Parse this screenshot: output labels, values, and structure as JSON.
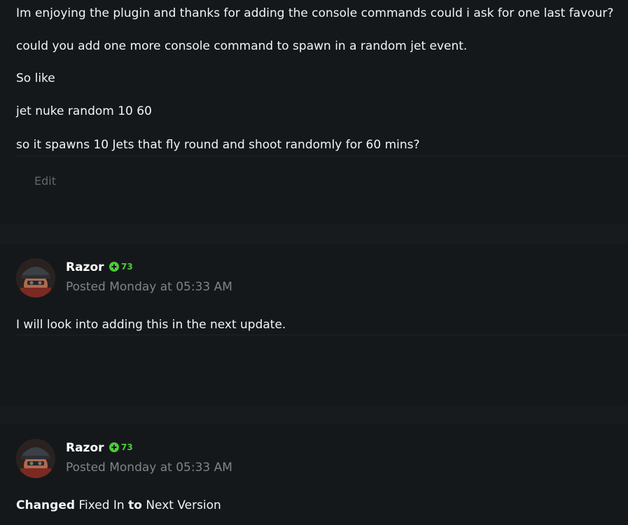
{
  "post": {
    "paragraphs": [
      "Im enjoying the plugin and thanks for adding the console commands could i ask for one last favour?",
      "could you add one more console command to spawn in a random jet event.",
      "So like",
      "jet nuke random 10 60",
      "so it spawns 10 Jets that fly round and shoot randomly for 60 mins?"
    ],
    "edit_label": "Edit"
  },
  "comments": [
    {
      "author": "Razor",
      "reputation": "73",
      "posted": "Posted Monday at 05:33 AM",
      "text": "I will look into adding this in the next update."
    },
    {
      "author": "Razor",
      "reputation": "73",
      "posted": "Posted Monday at 05:33 AM",
      "change": {
        "changed": "Changed",
        "field": "Fixed In",
        "to": "to",
        "value": "Next Version"
      }
    }
  ],
  "colors": {
    "background": "#15181a",
    "band": "#181b1d",
    "reputation_green": "#4ccc3a",
    "muted_text": "#7c858a"
  }
}
